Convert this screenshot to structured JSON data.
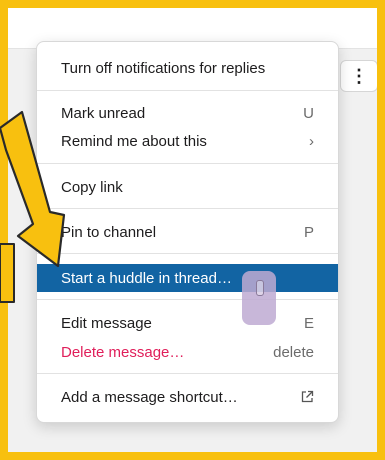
{
  "menu": {
    "items": [
      {
        "label": "Turn off notifications for replies",
        "shortcut": ""
      },
      {
        "label": "Mark unread",
        "shortcut": "U"
      },
      {
        "label": "Remind me about this",
        "shortcut": "›"
      },
      {
        "label": "Copy link",
        "shortcut": ""
      },
      {
        "label": "Pin to channel",
        "shortcut": "P"
      },
      {
        "label": "Start a huddle in thread…",
        "shortcut": ""
      },
      {
        "label": "Edit message",
        "shortcut": "E"
      },
      {
        "label": "Delete message…",
        "shortcut": "delete"
      },
      {
        "label": "Add a message shortcut…",
        "shortcut": ""
      }
    ]
  },
  "more_button": {
    "icon": "more-vertical-icon",
    "glyph": "⋮"
  },
  "colors": {
    "highlight": "#1264a3",
    "danger": "#e01e5a",
    "annotation_frame": "#f8c00f"
  }
}
